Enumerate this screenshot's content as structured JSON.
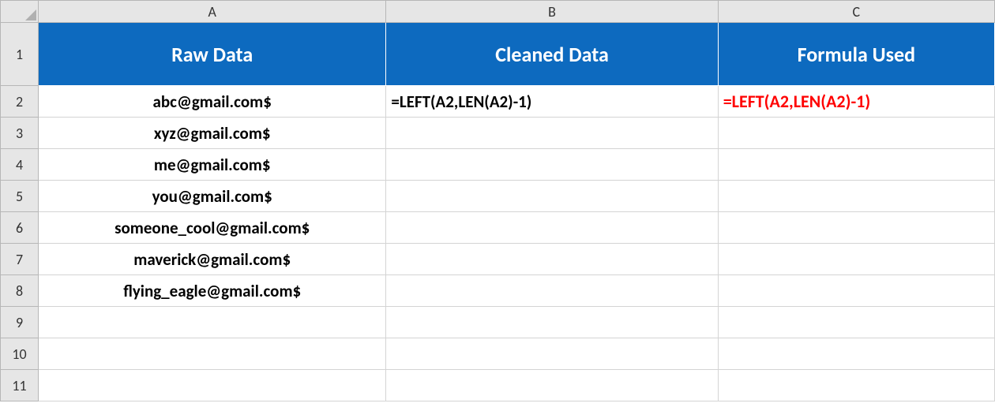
{
  "columns": {
    "A": "A",
    "B": "B",
    "C": "C"
  },
  "rowNumbers": [
    "1",
    "2",
    "3",
    "4",
    "5",
    "6",
    "7",
    "8",
    "9",
    "10",
    "11"
  ],
  "headers": {
    "A": "Raw Data",
    "B": "Cleaned Data",
    "C": "Formula Used"
  },
  "rawData": {
    "r2": "abc@gmail.com$",
    "r3": "xyz@gmail.com$",
    "r4": "me@gmail.com$",
    "r5": "you@gmail.com$",
    "r6": "someone_cool@gmail.com$",
    "r7": "maverick@gmail.com$",
    "r8": "flying_eagle@gmail.com$"
  },
  "cleanedData": {
    "r2": "=LEFT(A2,LEN(A2)-1)"
  },
  "formulaUsed": {
    "r2_p1": "=LEFT(",
    "r2_p2": "A2",
    "r2_p3": ",LEN(",
    "r2_p4": "A2",
    "r2_p5": ")",
    "r2_p6": "-1)"
  }
}
